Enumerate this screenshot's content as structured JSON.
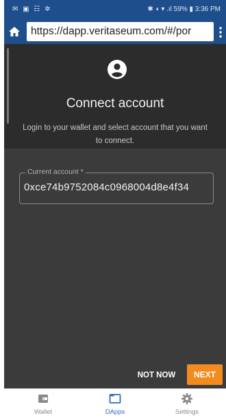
{
  "status_bar": {
    "left_icons": "✉ ▣ ☷ ✲",
    "right_text": "✱ ◖ ▾ .ıl 59% ▮ 3:36 PM"
  },
  "browser": {
    "url": "https://dapp.veritaseum.com/#/por"
  },
  "dialog": {
    "icon": "account-circle-icon",
    "title": "Connect account",
    "subtitle": "Login to your wallet and select account that you want to connect.",
    "field_label": "Current account *",
    "field_value": "0xce74b9752084c0968004d8e4f34"
  },
  "actions": {
    "not_now": "NOT NOW",
    "next": "NEXT"
  },
  "bottom_nav": {
    "items": [
      {
        "label": "Wallet",
        "icon": "wallet-icon"
      },
      {
        "label": "DApps",
        "icon": "dapps-icon"
      },
      {
        "label": "Settings",
        "icon": "gear-icon"
      }
    ],
    "active_index": 1
  },
  "colors": {
    "primary": "#1e4f8c",
    "accent": "#f28c1e",
    "active_tab": "#2e6db4"
  }
}
